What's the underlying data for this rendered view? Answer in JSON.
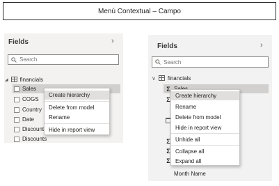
{
  "title": "Menú Contextual – Campo",
  "left_pane": {
    "header": "Fields",
    "search_placeholder": "Search",
    "table_name": "financials",
    "fields": [
      "Sales",
      "COGS",
      "Country",
      "Date",
      "Discount Band",
      "Discounts"
    ],
    "context_menu": [
      "Create hierarchy",
      "Delete from model",
      "Rename",
      "Hide in report view"
    ]
  },
  "right_pane": {
    "header": "Fields",
    "search_placeholder": "Search",
    "table_name": "financials",
    "selected_field": "Sales",
    "bottom_field": "Month Name",
    "context_menu": [
      "Create hierarchy",
      "Rename",
      "Delete from model",
      "Hide in report view",
      "Unhide all",
      "Collapse all",
      "Expand all"
    ]
  }
}
